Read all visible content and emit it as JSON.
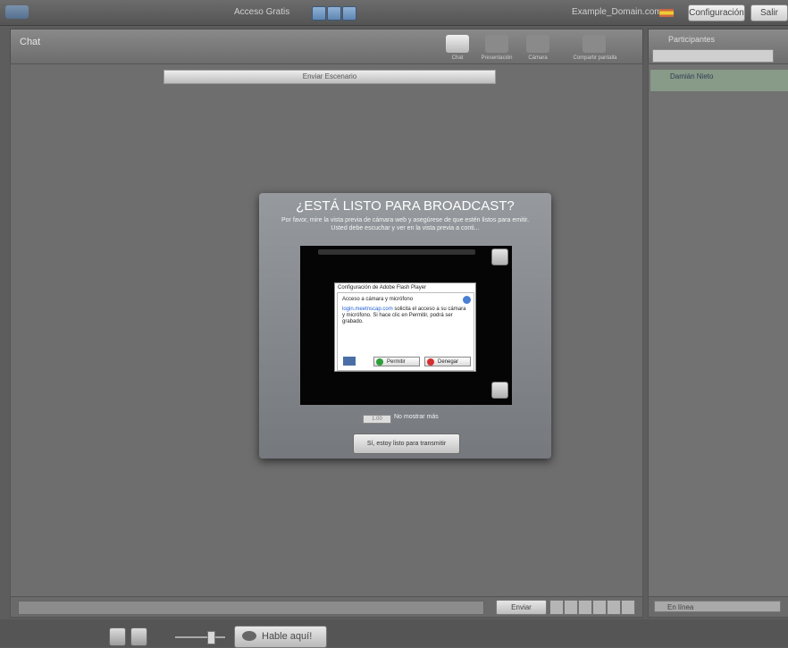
{
  "topbar": {
    "title": "Acceso Gratis",
    "user": "Example_Domain.com",
    "config_label": "Configuración",
    "exit_label": "Salir"
  },
  "chat": {
    "header_label": "Chat",
    "tabs_label": "Enviar Escenario",
    "tools": [
      {
        "name": "Chat"
      },
      {
        "name": "Presentación"
      },
      {
        "name": "Cámara"
      },
      {
        "name": "Compartir pantalla"
      }
    ],
    "send_label": "Enviar"
  },
  "participants": {
    "header_label": "Participantes",
    "user_name": "Damián Nieto",
    "status_label": "En línea"
  },
  "footer": {
    "talk_label": "Hable aquí!"
  },
  "modal": {
    "title": "¿ESTÁ LISTO PARA BROADCAST?",
    "description": "Por favor, mire la vista previa de cámara web y asegúrese de que estén listos para emitir. Usted debe escuchar y ver en la vista previa a conti...",
    "flash": {
      "title": "Configuración de Adobe Flash Player",
      "access": "Acceso a cámara y micrófono",
      "link": "login.meetnscap.com",
      "message": "solicita el acceso a su cámara y micrófono. Si hace clic en Permitir, podrá ser grabado.",
      "allow": "Permitir",
      "deny": "Denegar"
    },
    "checkbox_value": "1.00",
    "no_show_label": "No mostrar más",
    "ready_button": "Sí, estoy listo para transmitir"
  },
  "colors": {
    "accent": "#5f86b2",
    "allow": "#2e9e3a",
    "deny": "#d33030"
  }
}
